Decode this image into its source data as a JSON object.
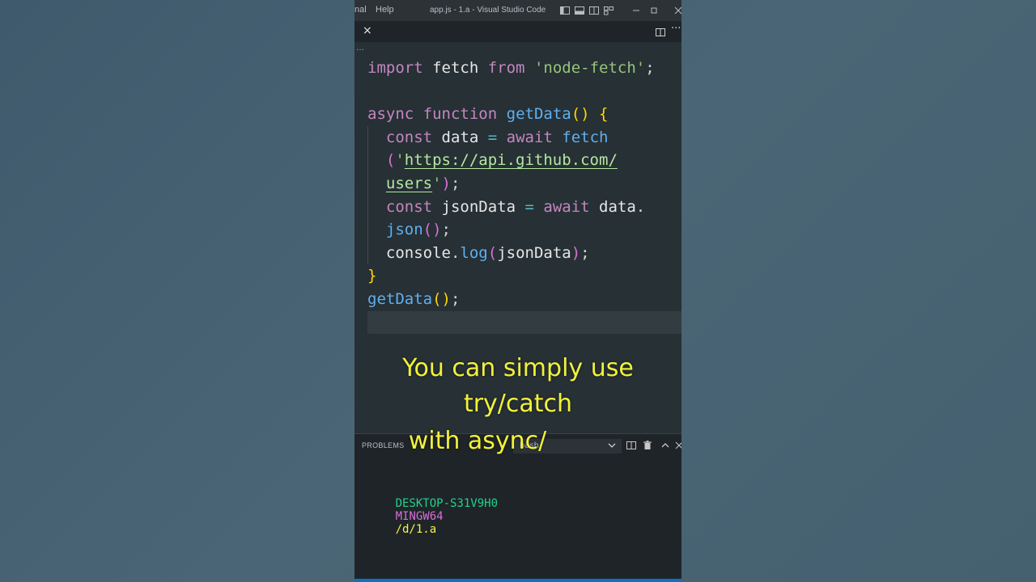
{
  "window": {
    "menu_items": [
      "nal",
      "Help"
    ],
    "title": "app.js - 1.a - Visual Studio Code"
  },
  "tabs": {
    "close_glyph": "×",
    "more_glyph": "···"
  },
  "breadcrumb": "…",
  "editor": {
    "lines": [
      [
        {
          "t": "import",
          "c": "kw"
        },
        {
          "t": " fetch ",
          "c": "id"
        },
        {
          "t": "from",
          "c": "kw"
        },
        {
          "t": " ",
          "c": "id"
        },
        {
          "t": "'node-fetch'",
          "c": "str"
        },
        {
          "t": ";",
          "c": "pun"
        }
      ],
      [],
      [
        {
          "t": "async",
          "c": "kw"
        },
        {
          "t": " ",
          "c": "id"
        },
        {
          "t": "function",
          "c": "kw"
        },
        {
          "t": " ",
          "c": "id"
        },
        {
          "t": "getData",
          "c": "fn"
        },
        {
          "t": "()",
          "c": "br1"
        },
        {
          "t": " ",
          "c": "id"
        },
        {
          "t": "{",
          "c": "br1"
        }
      ],
      [
        {
          "t": "  const",
          "c": "kw"
        },
        {
          "t": " data ",
          "c": "id"
        },
        {
          "t": "=",
          "c": "op"
        },
        {
          "t": " ",
          "c": "id"
        },
        {
          "t": "await",
          "c": "kw"
        },
        {
          "t": " ",
          "c": "id"
        },
        {
          "t": "fetch",
          "c": "fn"
        }
      ],
      [
        {
          "t": "  (",
          "c": "br2"
        },
        {
          "t": "'",
          "c": "str"
        },
        {
          "t": "https://api.github.com/",
          "c": "url"
        }
      ],
      [
        {
          "t": "  ",
          "c": "id"
        },
        {
          "t": "users",
          "c": "url"
        },
        {
          "t": "'",
          "c": "str"
        },
        {
          "t": ")",
          "c": "br2"
        },
        {
          "t": ";",
          "c": "pun"
        }
      ],
      [
        {
          "t": "  const",
          "c": "kw"
        },
        {
          "t": " jsonData ",
          "c": "id"
        },
        {
          "t": "=",
          "c": "op"
        },
        {
          "t": " ",
          "c": "id"
        },
        {
          "t": "await",
          "c": "kw"
        },
        {
          "t": " data",
          "c": "id"
        },
        {
          "t": ".",
          "c": "pun"
        }
      ],
      [
        {
          "t": "  json",
          "c": "fn"
        },
        {
          "t": "()",
          "c": "br2"
        },
        {
          "t": ";",
          "c": "pun"
        }
      ],
      [
        {
          "t": "  console",
          "c": "id"
        },
        {
          "t": ".",
          "c": "pun"
        },
        {
          "t": "log",
          "c": "fn"
        },
        {
          "t": "(",
          "c": "br2"
        },
        {
          "t": "jsonData",
          "c": "id"
        },
        {
          "t": ")",
          "c": "br2"
        },
        {
          "t": ";",
          "c": "pun"
        }
      ],
      [
        {
          "t": "}",
          "c": "br1"
        }
      ],
      [
        {
          "t": "getData",
          "c": "fn"
        },
        {
          "t": "()",
          "c": "br1"
        },
        {
          "t": ";",
          "c": "pun"
        }
      ],
      []
    ]
  },
  "caption": {
    "lines": [
      "You can simply use",
      "try/catch",
      "with async/"
    ]
  },
  "panel": {
    "problems_label": "PROBLEMS",
    "shell_label": "bash",
    "terminal": {
      "host": "DESKTOP-S31V9H0",
      "env": "MINGW64",
      "path": "/d/1.a"
    }
  },
  "colors": {
    "caption": "#f2f23a",
    "host": "#23d18b",
    "env": "#d670d6",
    "path": "#f5f543",
    "statusbar": "#0e70c0"
  }
}
